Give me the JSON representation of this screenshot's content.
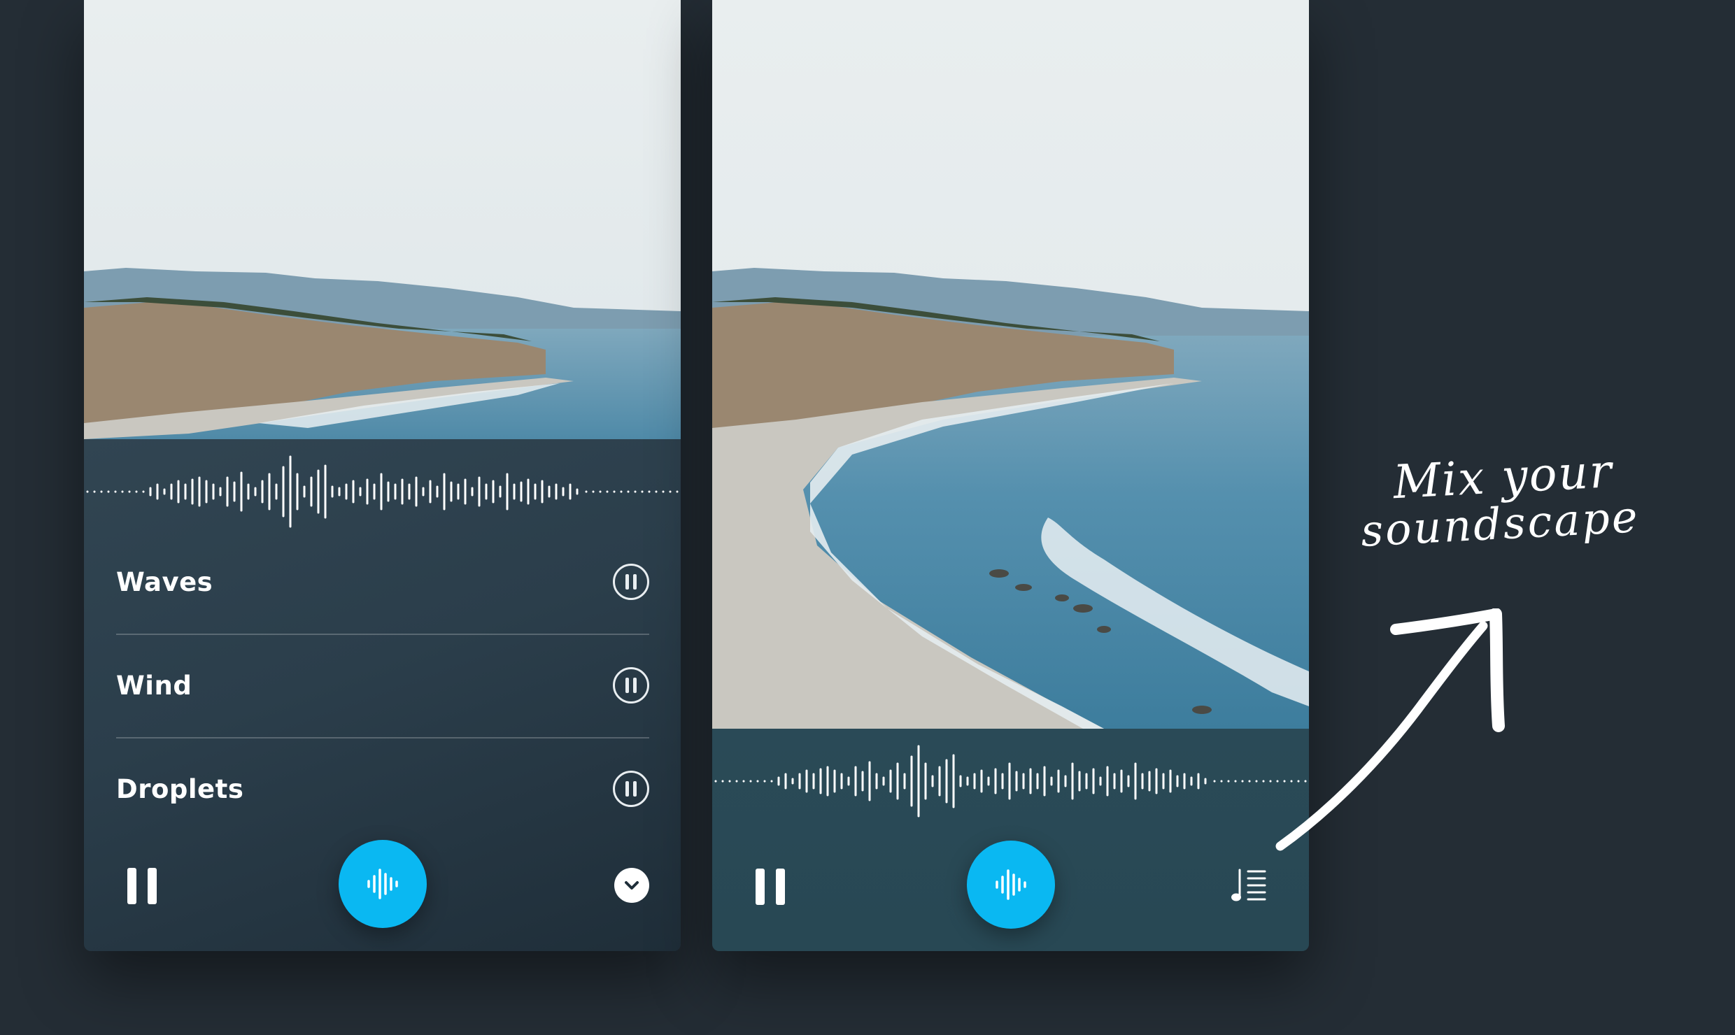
{
  "colors": {
    "background": "#242d35",
    "panel_left": "#2b3e4b",
    "panel_right": "#284854",
    "accent": "#0ab8f2",
    "text": "#ffffff"
  },
  "left_screen": {
    "photo": "coastal cliff beach photo (cropped)",
    "tracks": [
      {
        "label": "Waves",
        "state": "playing",
        "icon": "pause-circle-icon"
      },
      {
        "label": "Wind",
        "state": "playing",
        "icon": "pause-circle-icon"
      },
      {
        "label": "Droplets",
        "state": "playing",
        "icon": "pause-circle-icon"
      }
    ],
    "controls": {
      "play_pause_icon": "pause-icon",
      "mix_icon": "waveform-icon",
      "collapse_icon": "chevron-down-icon"
    }
  },
  "right_screen": {
    "photo": "coastal cliff beach photo (full)",
    "controls": {
      "play_pause_icon": "pause-icon",
      "mix_icon": "waveform-icon",
      "playlist_icon": "music-list-icon"
    }
  },
  "annotation": {
    "line1": "Mix your",
    "line2": "soundscape"
  }
}
